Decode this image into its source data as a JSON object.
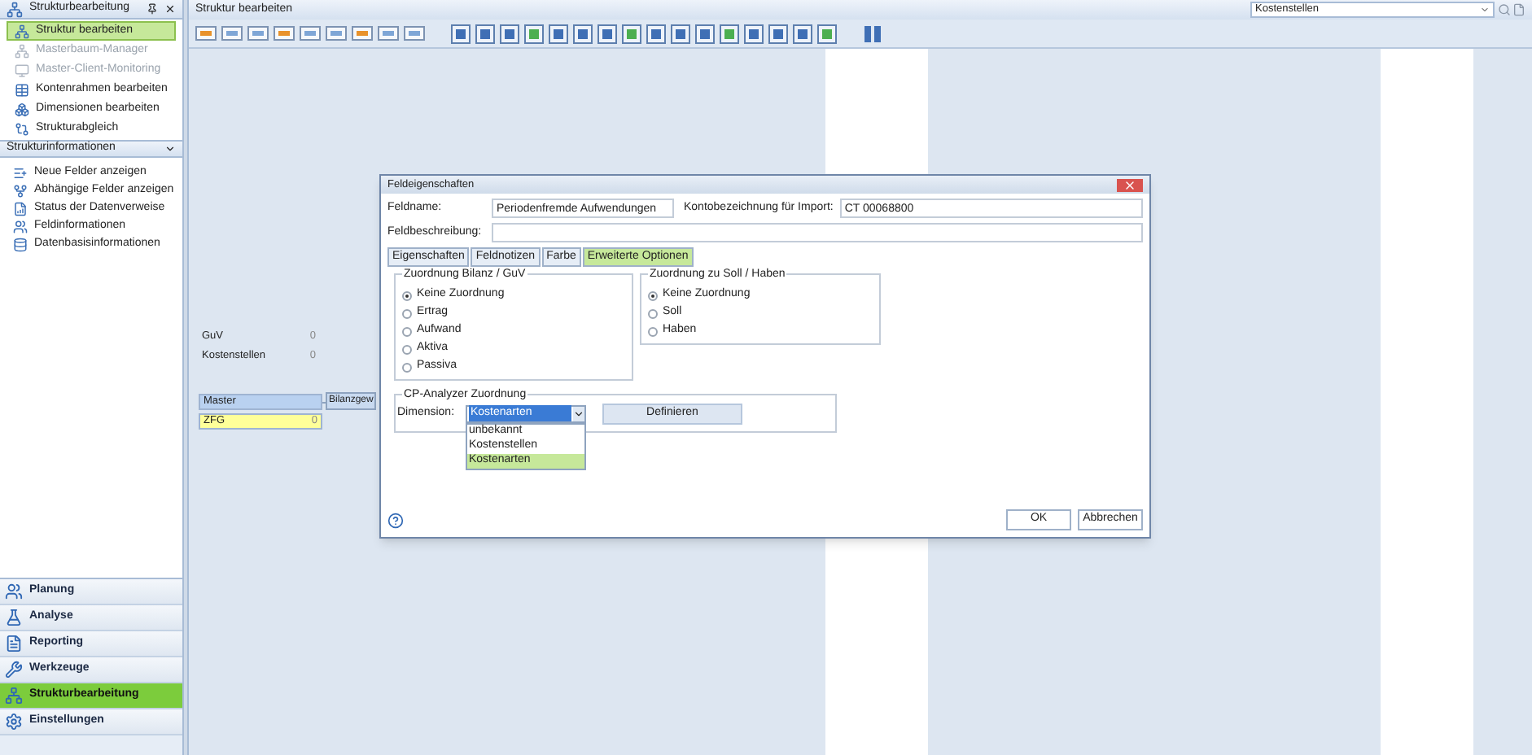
{
  "sidebar": {
    "title": "Strukturbearbeitung",
    "items": [
      {
        "label": "Struktur bearbeiten",
        "selected": true,
        "disabled": false
      },
      {
        "label": "Masterbaum-Manager",
        "selected": false,
        "disabled": true
      },
      {
        "label": "Master-Client-Monitoring",
        "selected": false,
        "disabled": true
      },
      {
        "label": "Kontenrahmen bearbeiten",
        "selected": false,
        "disabled": false
      },
      {
        "label": "Dimensionen bearbeiten",
        "selected": false,
        "disabled": false
      },
      {
        "label": "Strukturabgleich",
        "selected": false,
        "disabled": false
      }
    ],
    "info_section": {
      "title": "Strukturinformationen",
      "items": [
        "Neue Felder anzeigen",
        "Abhängige Felder anzeigen",
        "Status der Datenverweise",
        "Feldinformationen",
        "Datenbasisinformationen"
      ]
    },
    "nav": [
      {
        "label": "Planung",
        "selected": false
      },
      {
        "label": "Analyse",
        "selected": false
      },
      {
        "label": "Reporting",
        "selected": false
      },
      {
        "label": "Werkzeuge",
        "selected": false
      },
      {
        "label": "Strukturbearbeitung",
        "selected": true
      },
      {
        "label": "Einstellungen",
        "selected": false
      }
    ]
  },
  "main": {
    "title": "Struktur bearbeiten",
    "dimension_combo": {
      "value": "Kostenstellen"
    }
  },
  "canvas": {
    "rows": [
      {
        "label": "GuV",
        "count": "0"
      },
      {
        "label": "Kostenstellen",
        "count": "0"
      }
    ],
    "nodes": [
      {
        "label": "Master",
        "color": "#b9d1f0"
      },
      {
        "label": "ZFG",
        "color": "#ffff99",
        "count": "0"
      }
    ],
    "linked_node": {
      "label": "Bilanzgew"
    }
  },
  "dialog": {
    "title": "Feldeigenschaften",
    "field_name": {
      "label": "Feldname:",
      "value": "Periodenfremde Aufwendungen"
    },
    "import_name": {
      "label": "Kontobezeichnung für Import:",
      "value": "CT 00068800"
    },
    "description": {
      "label": "Feldbeschreibung:"
    },
    "tabs": [
      {
        "label": "Eigenschaften",
        "selected": false
      },
      {
        "label": "Feldnotizen",
        "selected": false
      },
      {
        "label": "Farbe",
        "selected": false
      },
      {
        "label": "Erweiterte Optionen",
        "selected": true
      }
    ],
    "groups": [
      {
        "title": "Zuordnung Bilanz / GuV",
        "options": [
          {
            "label": "Keine Zuordnung",
            "selected": true
          },
          {
            "label": "Ertrag",
            "selected": false
          },
          {
            "label": "Aufwand",
            "selected": false
          },
          {
            "label": "Aktiva",
            "selected": false
          },
          {
            "label": "Passiva",
            "selected": false
          }
        ]
      },
      {
        "title": "Zuordnung zu Soll / Haben",
        "options": [
          {
            "label": "Keine Zuordnung",
            "selected": true
          },
          {
            "label": "Soll",
            "selected": false
          },
          {
            "label": "Haben",
            "selected": false
          }
        ]
      }
    ],
    "analyzer": {
      "title": "CP-Analyzer Zuordnung",
      "label": "Dimension:",
      "value": "Kostenarten",
      "options": [
        {
          "label": "unbekannt",
          "selected": false
        },
        {
          "label": "Kostenstellen",
          "selected": false
        },
        {
          "label": "Kostenarten",
          "selected": true
        }
      ],
      "define_button": "Definieren"
    },
    "buttons": {
      "ok": "OK",
      "cancel": "Abbrechen"
    }
  }
}
